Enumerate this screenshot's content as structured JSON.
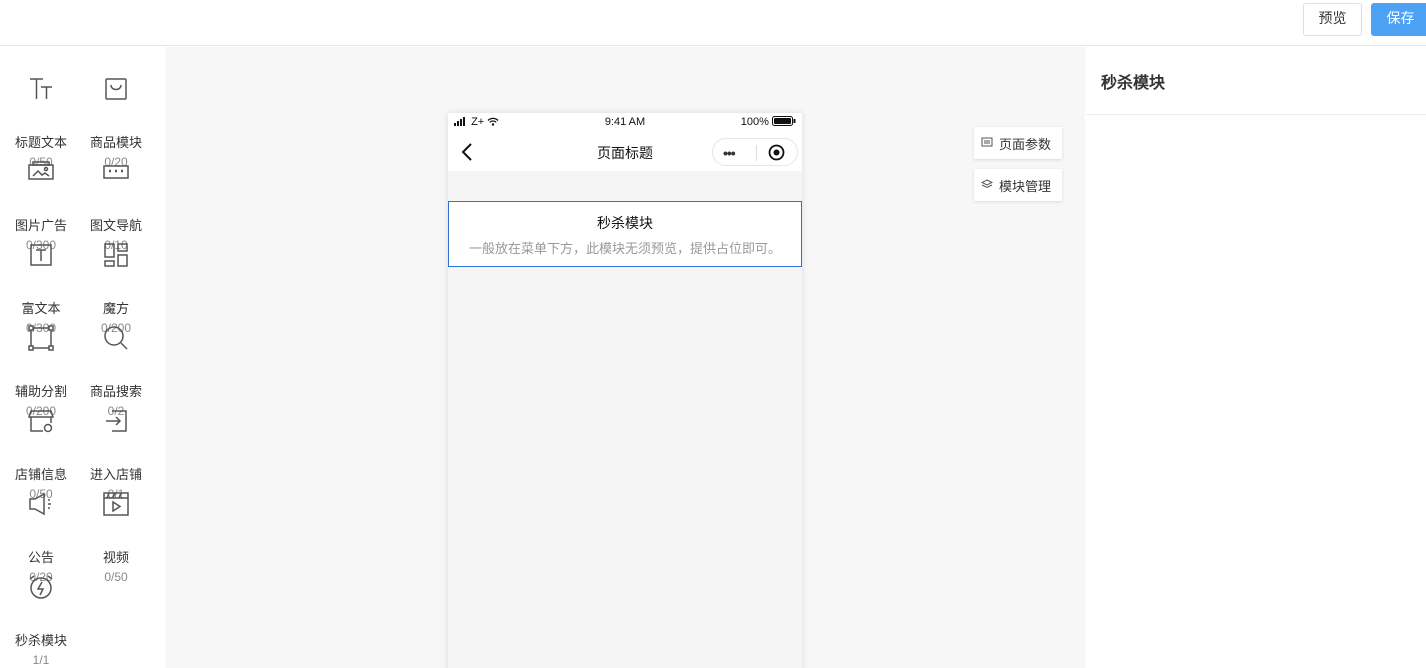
{
  "toolbar": {
    "preview_label": "预览",
    "save_label": "保存"
  },
  "widgets": [
    {
      "icon": "text-title-icon",
      "label": "标题文本",
      "count": "0/50"
    },
    {
      "icon": "shopping-bag-icon",
      "label": "商品模块",
      "count": "0/20"
    },
    {
      "icon": "image-ad-icon",
      "label": "图片广告",
      "count": "0/300"
    },
    {
      "icon": "image-nav-icon",
      "label": "图文导航",
      "count": "0/10"
    },
    {
      "icon": "rich-text-icon",
      "label": "富文本",
      "count": "0/300"
    },
    {
      "icon": "magic-cube-icon",
      "label": "魔方",
      "count": "0/200"
    },
    {
      "icon": "divider-icon",
      "label": "辅助分割",
      "count": "0/200"
    },
    {
      "icon": "search-icon",
      "label": "商品搜索",
      "count": "0/2"
    },
    {
      "icon": "store-info-icon",
      "label": "店铺信息",
      "count": "0/50"
    },
    {
      "icon": "enter-store-icon",
      "label": "进入店铺",
      "count": "0/1"
    },
    {
      "icon": "megaphone-icon",
      "label": "公告",
      "count": "0/20"
    },
    {
      "icon": "video-icon",
      "label": "视频",
      "count": "0/50"
    },
    {
      "icon": "alarm-clock-icon",
      "label": "秒杀模块",
      "count": "1/1"
    }
  ],
  "phone": {
    "status": {
      "signal": "Z+",
      "time": "9:41 AM",
      "battery": "100%"
    },
    "nav_title": "页面标题",
    "capsule_dots": "•••",
    "seckill": {
      "title": "秒杀模块",
      "desc": "一般放在菜单下方，此模块无须预览，提供占位即可。"
    }
  },
  "side_buttons": {
    "page_params": "页面参数",
    "module_manage": "模块管理"
  },
  "right_panel": {
    "title": "秒杀模块"
  }
}
